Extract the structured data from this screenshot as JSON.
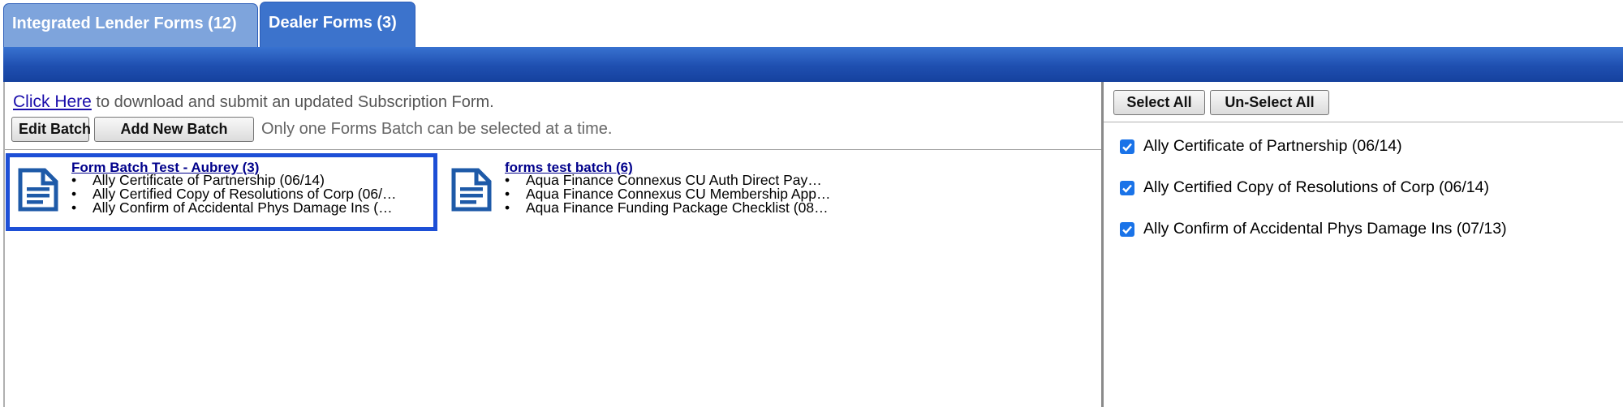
{
  "tabs": [
    {
      "label": "Integrated Lender Forms (12)",
      "active": false
    },
    {
      "label": "Dealer Forms (3)",
      "active": true
    }
  ],
  "left": {
    "link_text": "Click Here",
    "link_suffix": " to download and submit an updated Subscription Form.",
    "edit_batch": "Edit Batch",
    "add_new_batch": "Add New Batch",
    "note": "Only one Forms Batch can be selected at a time.",
    "batches": [
      {
        "title": "Form Batch Test - Aubrey (3)",
        "selected": true,
        "icon": "document-icon",
        "items": [
          "Ally Certificate of Partnership (06/14)",
          "Ally Certified Copy of Resolutions of Corp (06/…",
          "Ally Confirm of Accidental Phys Damage Ins (…"
        ]
      },
      {
        "title": "forms test batch (6)",
        "selected": false,
        "icon": "document-icon",
        "items": [
          "Aqua Finance Connexus CU Auth Direct Pay…",
          "Aqua Finance Connexus CU Membership App…",
          "Aqua Finance Funding Package Checklist (08…"
        ]
      }
    ]
  },
  "right": {
    "select_all": "Select All",
    "unselect_all": "Un-Select All",
    "forms": [
      {
        "label": "Ally Certificate of Partnership (06/14)",
        "checked": true
      },
      {
        "label": "Ally Certified Copy of Resolutions of Corp (06/14)",
        "checked": true
      },
      {
        "label": "Ally Confirm of Accidental Phys Damage Ins (07/13)",
        "checked": true
      }
    ]
  },
  "colors": {
    "tab_active": "#3c73cc",
    "tab_inactive": "#7ea4dc",
    "header_bar": "#1f4fb0",
    "selected_border": "#1d4fd6",
    "checkbox": "#1a73e8",
    "icon": "#1e5aa8"
  }
}
